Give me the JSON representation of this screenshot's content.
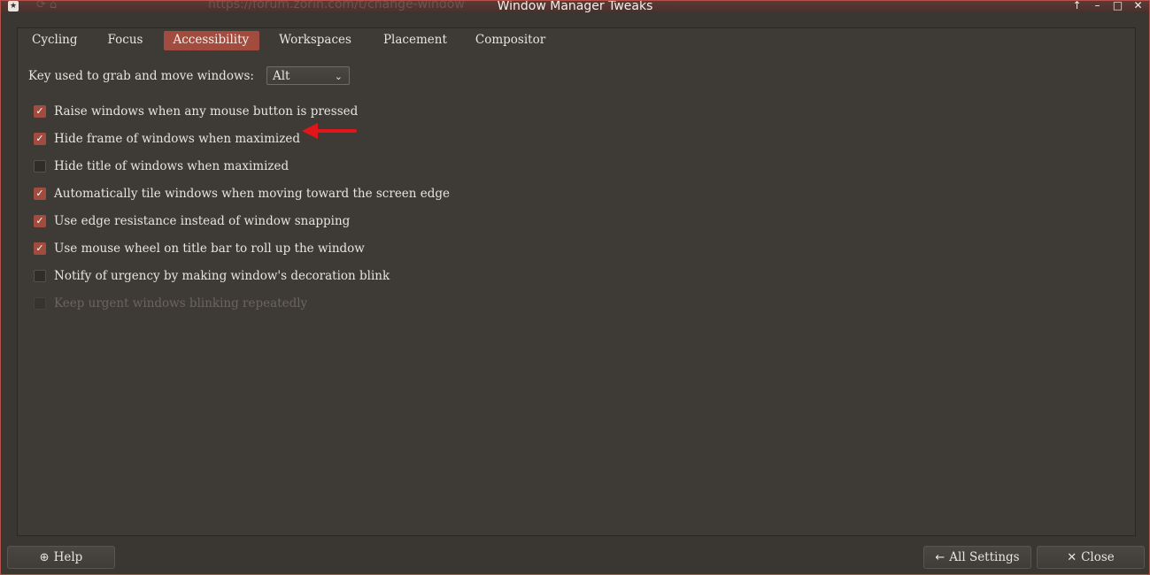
{
  "window": {
    "title": "Window Manager Tweaks",
    "background_url_fragment": "https://forum.zorin.com/t/change-window",
    "controls": [
      "up-icon",
      "minimize-icon",
      "maximize-icon",
      "close-icon"
    ]
  },
  "tabs": [
    {
      "label": "Cycling",
      "active": false
    },
    {
      "label": "Focus",
      "active": false
    },
    {
      "label": "Accessibility",
      "active": true
    },
    {
      "label": "Workspaces",
      "active": false
    },
    {
      "label": "Placement",
      "active": false
    },
    {
      "label": "Compositor",
      "active": false
    }
  ],
  "key_grab": {
    "label": "Key used to grab and move windows:",
    "value": "Alt"
  },
  "options": [
    {
      "label": "Raise windows when any mouse button is pressed",
      "checked": true
    },
    {
      "label": "Hide frame of windows when maximized",
      "checked": true
    },
    {
      "label": "Hide title of windows when maximized",
      "checked": false
    },
    {
      "label": "Automatically tile windows when moving toward the screen edge",
      "checked": true
    },
    {
      "label": "Use edge resistance instead of window snapping",
      "checked": true
    },
    {
      "label": "Use mouse wheel on title bar to roll up the window",
      "checked": true
    },
    {
      "label": "Notify of urgency by making window's decoration blink",
      "checked": false
    },
    {
      "label": "Keep urgent windows blinking repeatedly",
      "checked": false,
      "disabled": true
    }
  ],
  "buttons": {
    "help": "Help",
    "all_settings": "All Settings",
    "close": "Close"
  },
  "colors": {
    "accent": "#a24c40",
    "background": "#3a3632",
    "annotation_arrow": "#e0161b"
  }
}
